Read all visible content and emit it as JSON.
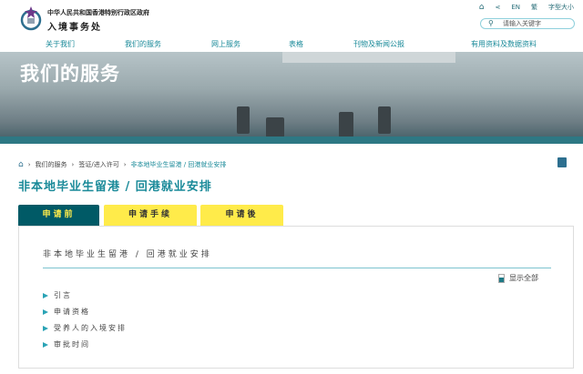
{
  "header": {
    "gov_name": "中华人民共和国香港特别行政区政府",
    "dept_name": "入境事务处",
    "utility": {
      "english": "EN",
      "traditional": "繁",
      "font_size": "字型大小"
    },
    "search_placeholder": "请输入关键字"
  },
  "nav": [
    "关于我们",
    "我们的服务",
    "网上服务",
    "表格",
    "刊物及新闻公报",
    "有用资料及数据资料"
  ],
  "banner": {
    "title": "我们的服务"
  },
  "breadcrumb": [
    "我们的服务",
    "签证/进入许可",
    "非本地毕业生留港 / 回港就业安排"
  ],
  "page_title": "非本地毕业生留港 / 回港就业安排",
  "tabs": [
    {
      "label": "申请前",
      "active": true
    },
    {
      "label": "申请手续",
      "active": false
    },
    {
      "label": "申请後",
      "active": false
    }
  ],
  "panel": {
    "title": "非本地毕业生留港 / 回港就业安排",
    "show_all": "显示全部",
    "items": [
      "引言",
      "申请资格",
      "受养人的入境安排",
      "审批时间"
    ]
  },
  "colors": {
    "accent": "#1a8a99",
    "tab_active": "#005a66",
    "tab_inactive": "#ffeb4a"
  }
}
